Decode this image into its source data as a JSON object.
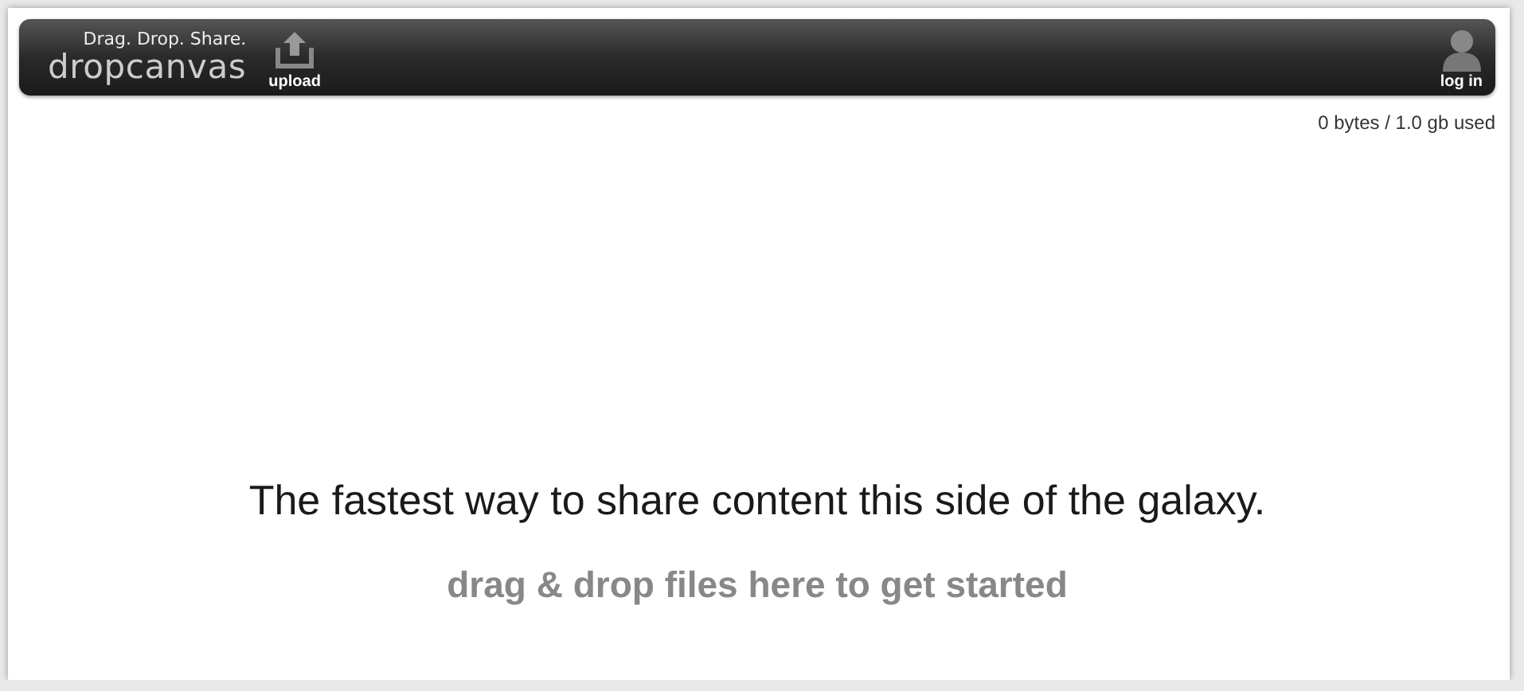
{
  "header": {
    "tagline": "Drag. Drop. Share.",
    "logo": "dropcanvas",
    "upload_label": "upload",
    "login_label": "log in"
  },
  "usage": "0 bytes / 1.0 gb used",
  "headline": "The fastest way to share content this side of the galaxy.",
  "hint": "drag & drop files here to get started"
}
